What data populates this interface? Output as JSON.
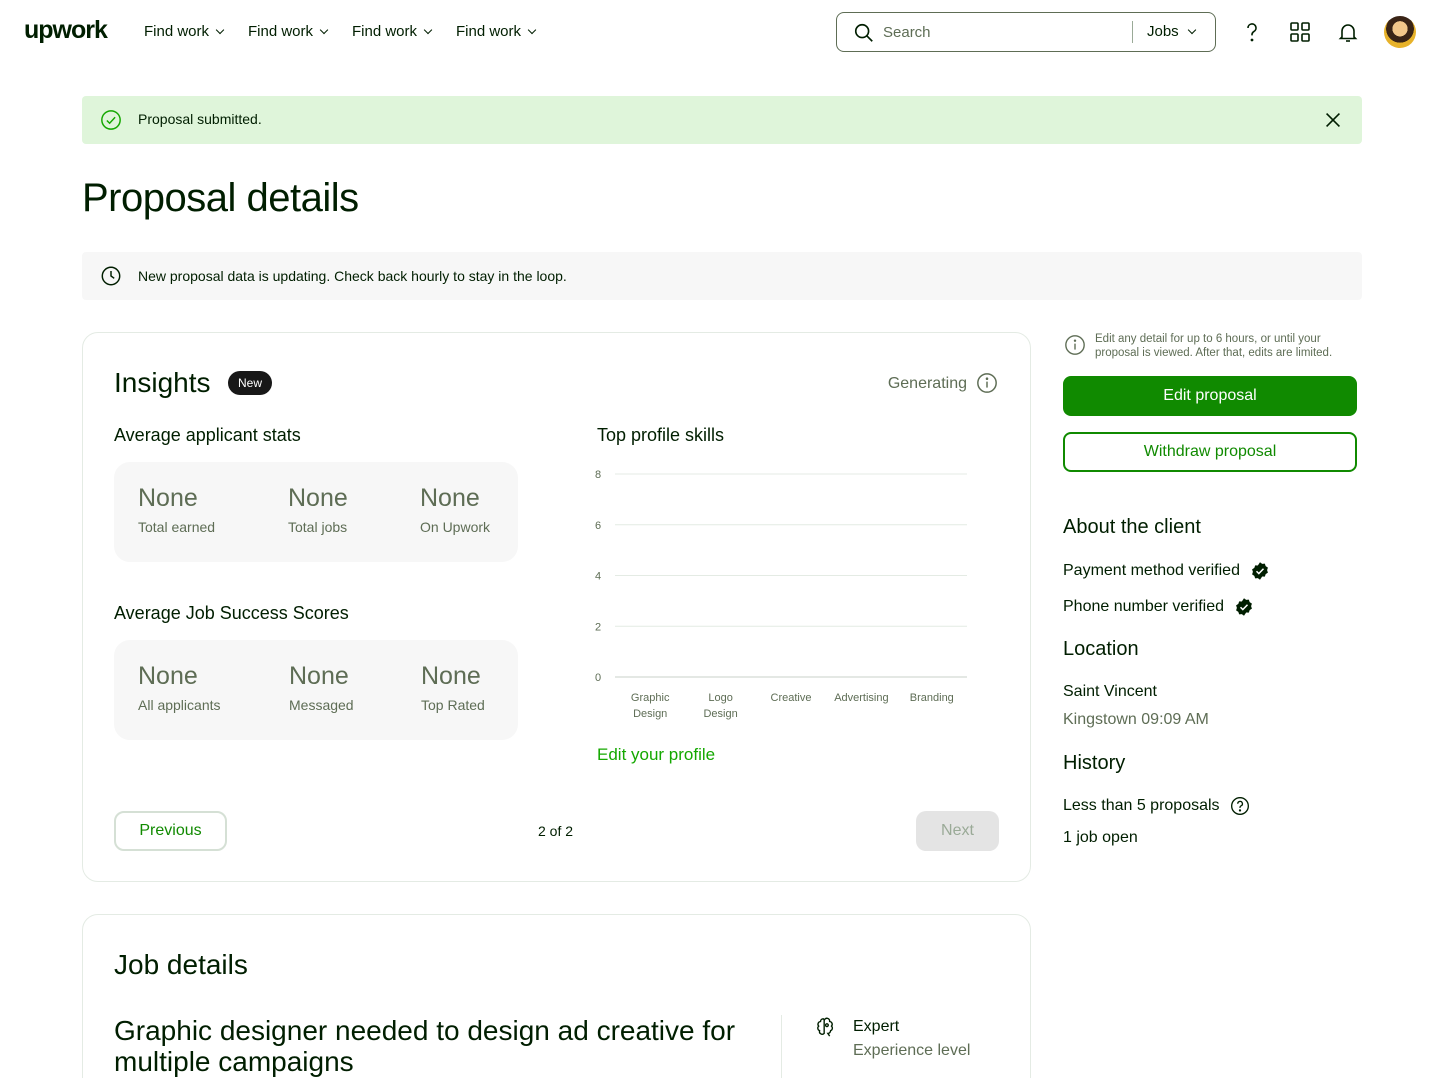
{
  "header": {
    "logo": "upwork",
    "nav": [
      "Find work",
      "Find work",
      "Find work",
      "Find work"
    ],
    "search_placeholder": "Search",
    "search_scope": "Jobs"
  },
  "banner_success": {
    "message": "Proposal submitted."
  },
  "page_title": "Proposal details",
  "banner_info": {
    "message": "New proposal data is updating. Check back hourly to stay in the loop."
  },
  "insights": {
    "title": "Insights",
    "badge": "New",
    "status": "Generating",
    "applicant_stats": {
      "label": "Average applicant stats",
      "stats": [
        {
          "value": "None",
          "label": "Total earned"
        },
        {
          "value": "None",
          "label": "Total jobs"
        },
        {
          "value": "None",
          "label": "On Upwork"
        }
      ]
    },
    "jss": {
      "label": "Average Job Success Scores",
      "stats": [
        {
          "value": "None",
          "label": "All applicants"
        },
        {
          "value": "None",
          "label": "Messaged"
        },
        {
          "value": "None",
          "label": "Top Rated"
        }
      ]
    },
    "skills_title": "Top profile skills",
    "edit_profile_link": "Edit your profile",
    "pager": {
      "previous": "Previous",
      "position": "2 of 2",
      "next": "Next"
    }
  },
  "chart_data": {
    "type": "bar",
    "title": "Top profile skills",
    "categories": [
      "Graphic Design",
      "Logo Design",
      "Creative",
      "Advertising",
      "Branding"
    ],
    "category_lines": [
      [
        "Graphic",
        "Design"
      ],
      [
        "Logo",
        "Design"
      ],
      [
        "Creative"
      ],
      [
        "Advertising"
      ],
      [
        "Branding"
      ]
    ],
    "values": [
      0,
      0,
      0,
      0,
      0
    ],
    "yticks": [
      0,
      2,
      4,
      6,
      8
    ],
    "ylim": [
      0,
      8
    ],
    "grid": true
  },
  "sidebar": {
    "edit_note": "Edit any detail for up to 6 hours, or until your proposal is viewed. After that, edits are limited.",
    "edit_button": "Edit proposal",
    "withdraw_button": "Withdraw proposal",
    "about_title": "About the client",
    "payment_verified": "Payment method verified",
    "phone_verified": "Phone number verified",
    "location_title": "Location",
    "location_country": "Saint Vincent",
    "location_time": "Kingstown 09:09 AM",
    "history_title": "History",
    "proposals": "Less than 5 proposals",
    "jobs_open": "1 job open"
  },
  "job_details": {
    "title": "Job details",
    "job_title": "Graphic designer needed to design ad creative for multiple campaigns",
    "level": "Expert",
    "level_label": "Experience level"
  }
}
